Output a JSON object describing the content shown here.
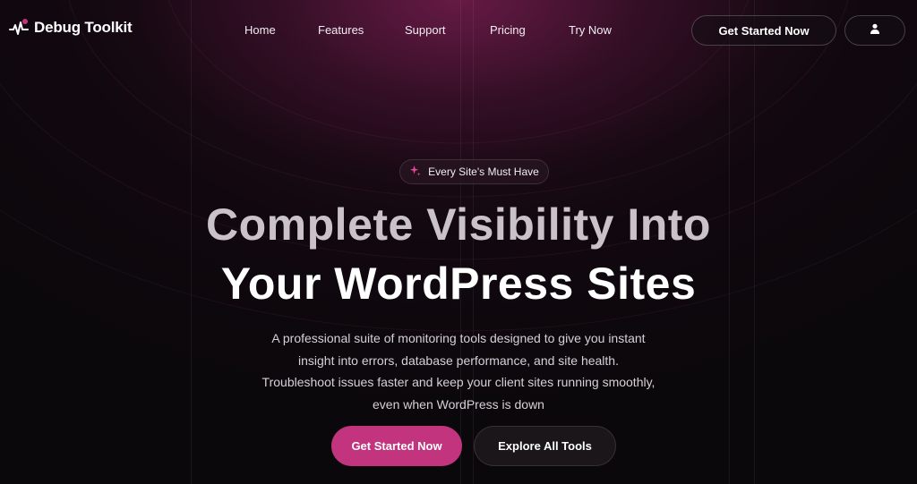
{
  "nav": {
    "brand": "Debug Toolkit",
    "links": [
      "Home",
      "Features",
      "Support",
      "Pricing",
      "Try Now"
    ],
    "cta_label": "Get Started Now",
    "account_icon": "user-icon"
  },
  "hero": {
    "badge_label": "Every Site's Must Have",
    "badge_icon": "sparkle-icon",
    "title_line1": "Complete Visibility Into",
    "title_line2": "Your WordPress Sites",
    "description": "A professional suite of monitoring tools designed to give you instant insight into errors, database performance, and site health. Troubleshoot issues faster and keep your client sites running smoothly, even when WordPress is down",
    "primary_cta": "Get Started Now",
    "secondary_cta": "Explore All Tools"
  },
  "colors": {
    "accent": "#c2347d",
    "background": "#0a080b",
    "glow": "#78204f"
  }
}
